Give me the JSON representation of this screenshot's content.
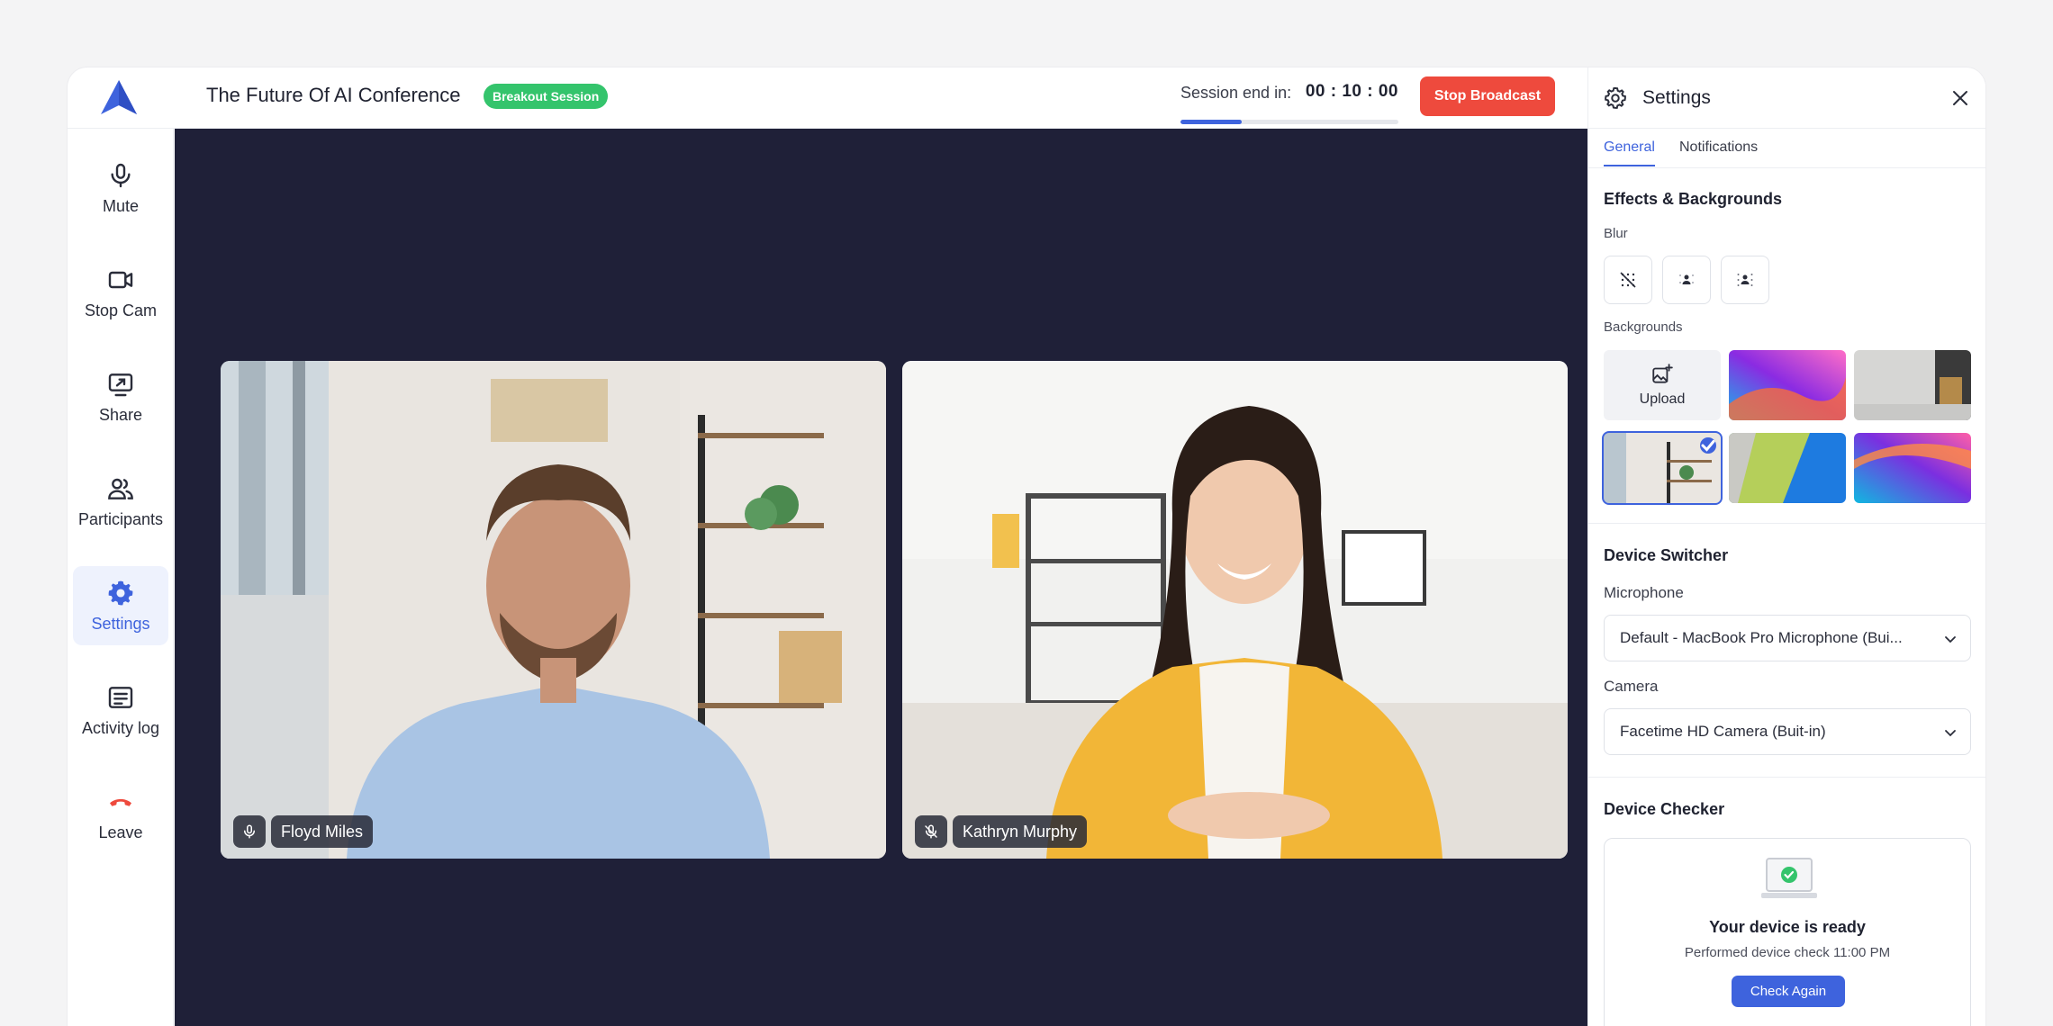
{
  "header": {
    "title": "The Future Of AI Conference",
    "badge": "Breakout Session",
    "session_label": "Session end in:",
    "session_time": "00 : 10 : 00",
    "session_progress": 0.28,
    "stop_label": "Stop Broadcast"
  },
  "sidebar": {
    "items": [
      {
        "label": "Mute",
        "icon": "microphone-icon"
      },
      {
        "label": "Stop Cam",
        "icon": "video-camera-icon"
      },
      {
        "label": "Share",
        "icon": "screen-share-icon"
      },
      {
        "label": "Participants",
        "icon": "users-icon"
      },
      {
        "label": "Settings",
        "icon": "gear-icon",
        "active": true
      },
      {
        "label": "Activity log",
        "icon": "list-icon"
      },
      {
        "label": "Leave",
        "icon": "phone-hangup-icon"
      }
    ]
  },
  "participants": [
    {
      "name": "Floyd Miles",
      "mic": "on"
    },
    {
      "name": "Kathryn Murphy",
      "mic": "muted"
    }
  ],
  "settings": {
    "title": "Settings",
    "tabs": [
      {
        "label": "General",
        "active": true
      },
      {
        "label": "Notifications",
        "active": false
      }
    ],
    "effects_title": "Effects & Backgrounds",
    "blur_label": "Blur",
    "backgrounds_label": "Backgrounds",
    "upload_label": "Upload",
    "device_switcher_title": "Device Switcher",
    "microphone_label": "Microphone",
    "microphone_value": "Default - MacBook Pro Microphone (Bui...",
    "camera_label": "Camera",
    "camera_value": "Facetime HD Camera (Buit-in)",
    "device_checker_title": "Device Checker",
    "ready_title": "Your device is ready",
    "ready_sub": "Performed device check 11:00 PM",
    "check_again_label": "Check Again"
  },
  "colors": {
    "accent": "#3e63dd",
    "danger": "#ee4a3d",
    "badge": "#34c46c",
    "stage": "#1f2038"
  }
}
